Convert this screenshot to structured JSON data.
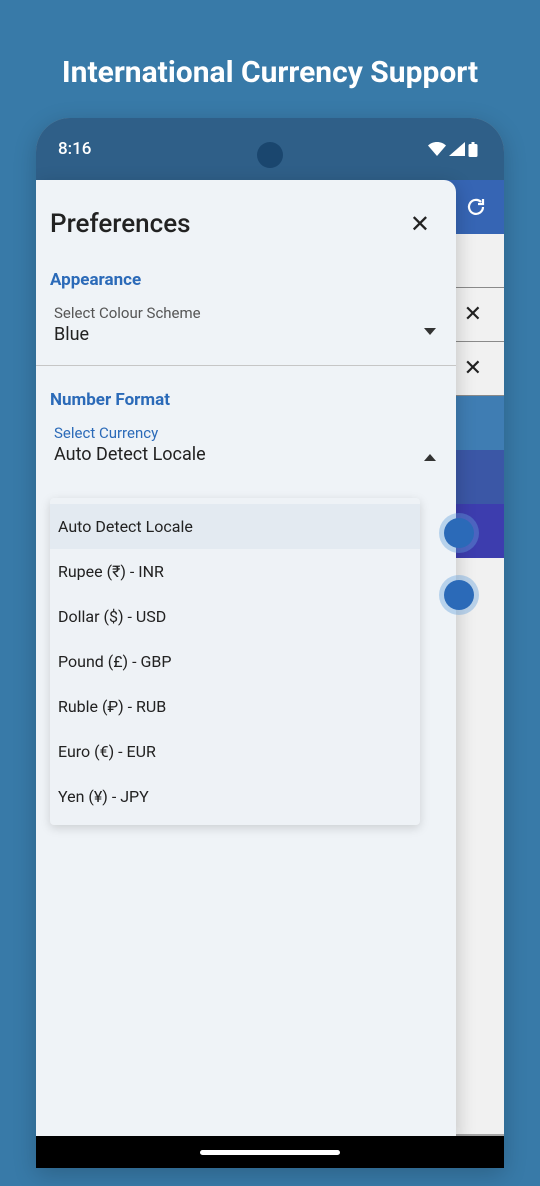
{
  "page_title": "International Currency Support",
  "status": {
    "time": "8:16"
  },
  "modal": {
    "title": "Preferences",
    "sections": {
      "appearance": {
        "heading": "Appearance",
        "scheme_label": "Select Colour Scheme",
        "scheme_value": "Blue"
      },
      "number_format": {
        "heading": "Number Format",
        "currency_label": "Select Currency",
        "currency_value": "Auto Detect Locale"
      }
    }
  },
  "options": [
    "Auto Detect Locale",
    "Rupee (₹) - INR",
    "Dollar ($) - USD",
    "Pound (£) - GBP",
    "Ruble (₽) - RUB",
    "Euro (€) - EUR",
    "Yen (¥) - JPY"
  ]
}
